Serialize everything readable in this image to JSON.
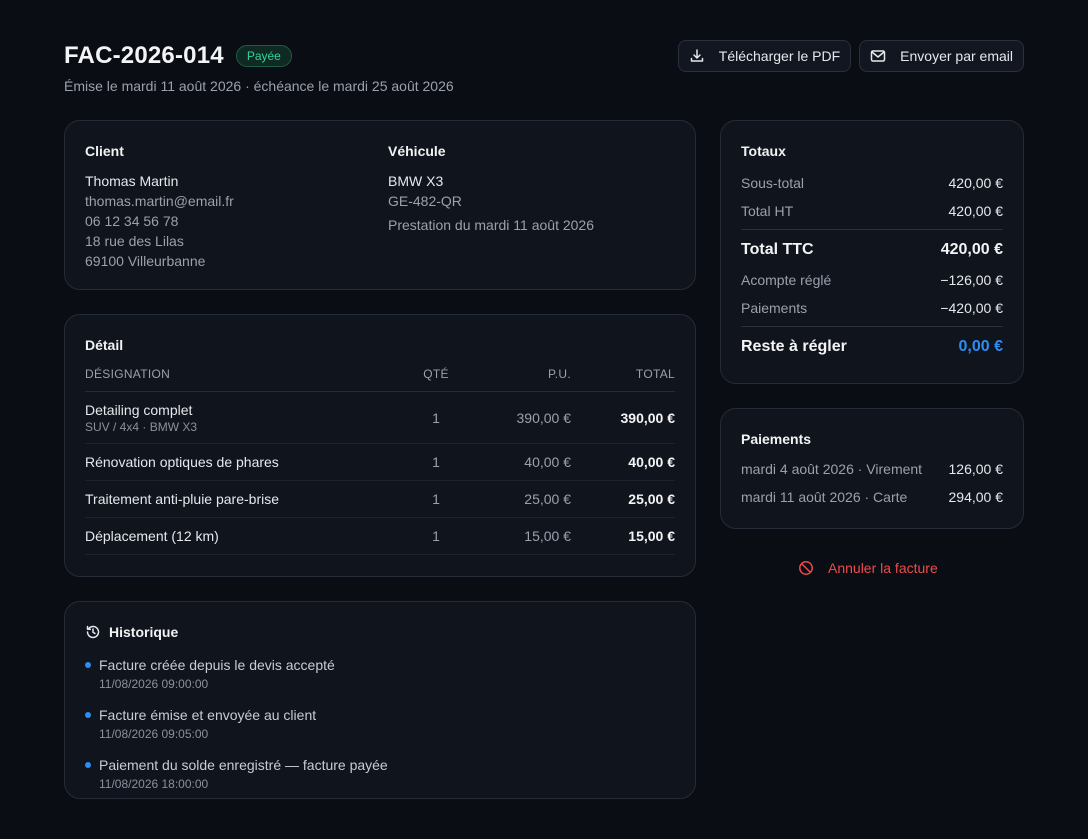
{
  "header": {
    "invoice_number": "FAC-2026-014",
    "status": "Payée",
    "subtitle": "Émise le mardi 11 août 2026 · échéance le mardi 25 août 2026",
    "download_label": "Télécharger le PDF",
    "email_label": "Envoyer par email"
  },
  "client": {
    "title": "Client",
    "name": "Thomas Martin",
    "email": "thomas.martin@email.fr",
    "phone": "06 12 34 56 78",
    "address1": "18 rue des Lilas",
    "address2": "69100 Villeurbanne"
  },
  "vehicle": {
    "title": "Véhicule",
    "model": "BMW X3",
    "plate": "GE-482-QR",
    "service_date": "Prestation du mardi 11 août 2026"
  },
  "detail": {
    "title": "Détail",
    "columns": {
      "designation": "DÉSIGNATION",
      "qty": "QTÉ",
      "unit_price": "P.U.",
      "total": "TOTAL"
    },
    "rows": [
      {
        "designation": "Detailing complet",
        "sub": "SUV / 4x4 · BMW X3",
        "qty": "1",
        "unit_price": "390,00 €",
        "total": "390,00 €"
      },
      {
        "designation": "Rénovation optiques de phares",
        "qty": "1",
        "unit_price": "40,00 €",
        "total": "40,00 €"
      },
      {
        "designation": "Traitement anti-pluie pare-brise",
        "qty": "1",
        "unit_price": "25,00 €",
        "total": "25,00 €"
      },
      {
        "designation": "Déplacement (12 km)",
        "qty": "1",
        "unit_price": "15,00 €",
        "total": "15,00 €"
      }
    ]
  },
  "history": {
    "title": "Historique",
    "items": [
      {
        "text": "Facture créée depuis le devis accepté",
        "time": "11/08/2026 09:00:00"
      },
      {
        "text": "Facture émise et envoyée au client",
        "time": "11/08/2026 09:05:00"
      },
      {
        "text": "Paiement du solde enregistré — facture payée",
        "time": "11/08/2026 18:00:00"
      }
    ]
  },
  "totals": {
    "title": "Totaux",
    "subtotal_label": "Sous-total",
    "subtotal": "420,00 €",
    "ht_label": "Total HT",
    "ht": "420,00 €",
    "ttc_label": "Total TTC",
    "ttc": "420,00 €",
    "deposit_label": "Acompte réglé",
    "deposit": "−126,00 €",
    "payments_label": "Paiements",
    "payments": "−420,00 €",
    "due_label": "Reste à régler",
    "due": "0,00 €"
  },
  "payments": {
    "title": "Paiements",
    "items": [
      {
        "label": "mardi 4 août 2026 · Virement",
        "amount": "126,00 €"
      },
      {
        "label": "mardi 11 août 2026 · Carte",
        "amount": "294,00 €"
      }
    ]
  },
  "cancel_label": "Annuler la facture",
  "colors": {
    "accent": "#2f8cf3",
    "success": "#34d399",
    "danger": "#f04a4a",
    "background": "#0a0d14"
  }
}
